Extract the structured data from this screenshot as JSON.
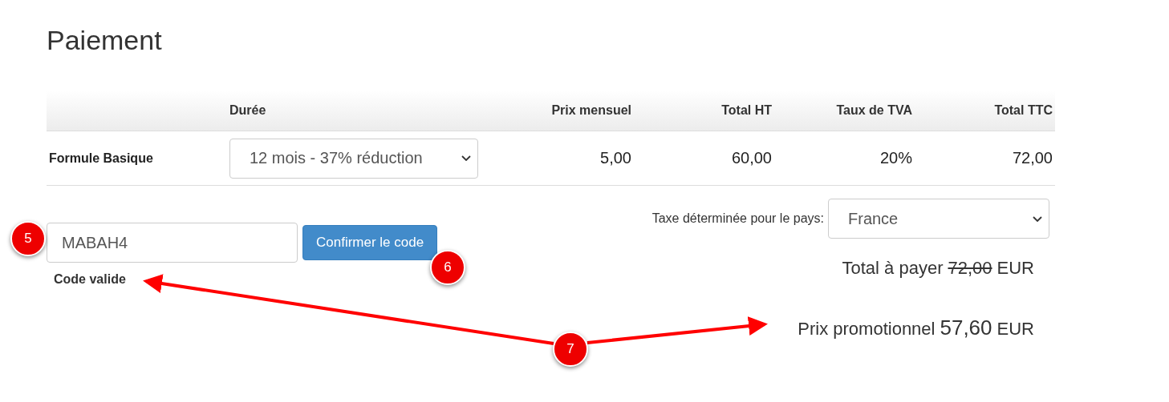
{
  "title": "Paiement",
  "table": {
    "columns": [
      "",
      "Durée",
      "Prix mensuel",
      "Total HT",
      "Taux de TVA",
      "Total TTC"
    ],
    "rows": [
      {
        "plan": "Formule Basique",
        "duration": "12 mois - 37% réduction",
        "monthly_price": "5,00",
        "total_ht": "60,00",
        "vat_rate": "20%",
        "total_ttc": "72,00"
      }
    ]
  },
  "promo": {
    "code": "MABAH4",
    "button": "Confirmer le code",
    "status": "Code valide"
  },
  "tax": {
    "label": "Taxe déterminée pour le pays:",
    "country": "France"
  },
  "total": {
    "label": "Total à payer",
    "old_price": "72,00",
    "currency": "EUR"
  },
  "promo_price": {
    "label": "Prix promotionnel",
    "price": "57,60",
    "currency": "EUR"
  },
  "annotations": [
    {
      "label": "5"
    },
    {
      "label": "6"
    },
    {
      "label": "7"
    }
  ]
}
